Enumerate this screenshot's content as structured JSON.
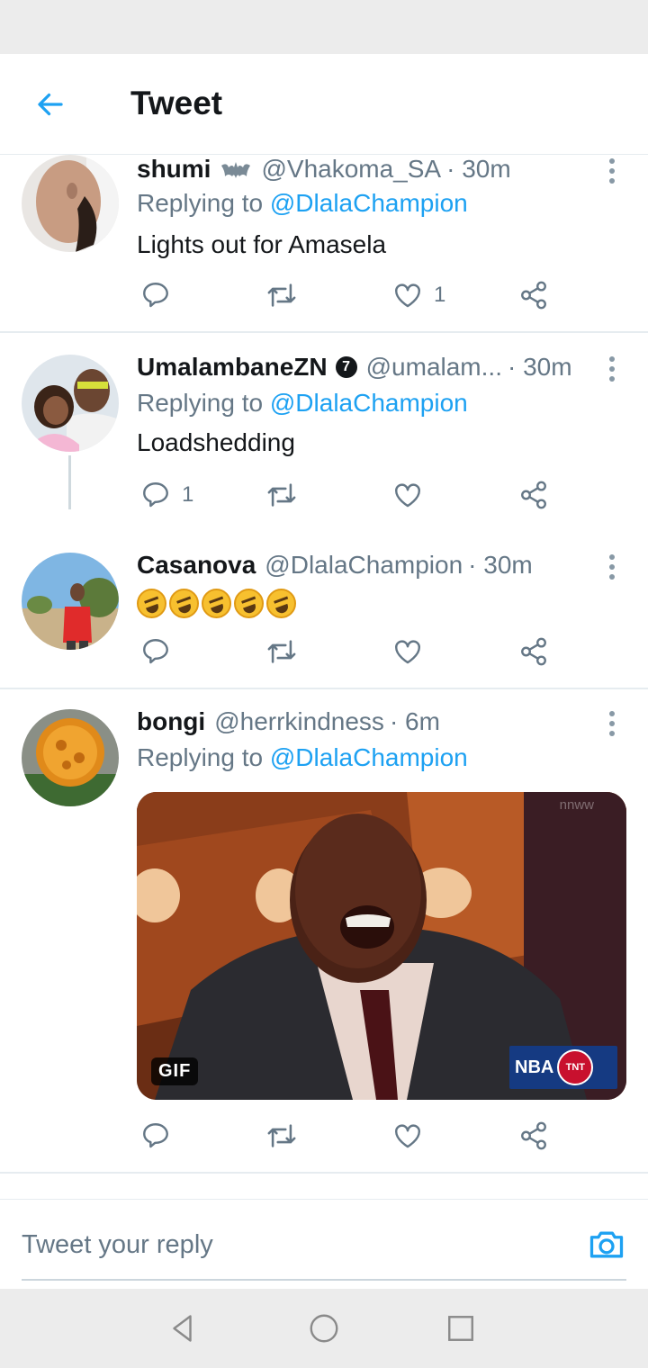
{
  "header": {
    "title": "Tweet"
  },
  "tweets": [
    {
      "name": "shumi",
      "handle": "@Vhakoma_SA",
      "time": "· 30m",
      "replying_prefix": "Replying to",
      "replying_to": "@DlalaChampion",
      "text": "Lights out for Amasela",
      "reply_count": "",
      "like_count": "1"
    },
    {
      "name": "UmalambaneZN",
      "badge": "7",
      "handle": "@umalam...",
      "time": "· 30m",
      "replying_prefix": "Replying to",
      "replying_to": "@DlalaChampion",
      "text": "Loadshedding",
      "reply_count": "1",
      "like_count": ""
    },
    {
      "name": "Casanova",
      "handle": "@DlalaChampion",
      "time": "· 30m",
      "emoji_count": 5,
      "reply_count": "",
      "like_count": ""
    },
    {
      "name": "bongi",
      "handle": "@herrkindness",
      "time": "· 6m",
      "replying_prefix": "Replying to",
      "replying_to": "@DlalaChampion",
      "media": {
        "badge": "GIF",
        "network_logo": "NBA",
        "network_logo_2": "TNT",
        "watermark": "nnww"
      },
      "reply_count": "",
      "like_count": ""
    }
  ],
  "reply_bar": {
    "placeholder": "Tweet your reply"
  },
  "colors": {
    "accent": "#1da1f2",
    "text": "#14171a",
    "secondary": "#657786"
  },
  "icons": [
    "back-arrow-icon",
    "more-vertical-icon",
    "reply-icon",
    "retweet-icon",
    "like-icon",
    "share-icon",
    "camera-icon",
    "nav-back-icon",
    "nav-home-icon",
    "nav-recents-icon"
  ]
}
